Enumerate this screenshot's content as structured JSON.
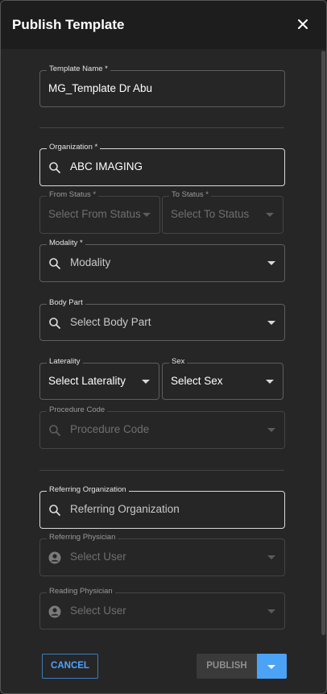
{
  "dialog": {
    "title": "Publish Template"
  },
  "fields": {
    "template_name": {
      "label": "Template Name *",
      "value": "MG_Template Dr Abu"
    },
    "organization": {
      "label": "Organization *",
      "value": "ABC IMAGING"
    },
    "from_status": {
      "label": "From Status *",
      "placeholder": "Select From Status"
    },
    "to_status": {
      "label": "To Status *",
      "placeholder": "Select To Status"
    },
    "modality": {
      "label": "Modality *",
      "placeholder": "Modality"
    },
    "body_part": {
      "label": "Body Part",
      "placeholder": "Select Body Part"
    },
    "laterality": {
      "label": "Laterality",
      "value": "Select Laterality"
    },
    "sex": {
      "label": "Sex",
      "value": "Select Sex"
    },
    "procedure_code": {
      "label": "Procedure Code",
      "placeholder": "Procedure Code"
    },
    "referring_organization": {
      "label": "Referring Organization",
      "placeholder": "Referring Organization"
    },
    "referring_physician": {
      "label": "Referring Physician",
      "placeholder": "Select User"
    },
    "reading_physician": {
      "label": "Reading Physician",
      "placeholder": "Select User"
    }
  },
  "actions": {
    "cancel": "CANCEL",
    "publish": "PUBLISH"
  },
  "icons": {
    "close": "close-icon",
    "search": "search-icon",
    "user": "user-avatar-icon",
    "dropdown": "chevron-down-icon"
  },
  "colors": {
    "accent": "#4aa3f5",
    "cancel_text": "#4da3ff",
    "background": "#262626",
    "header": "#1d1d1d"
  }
}
